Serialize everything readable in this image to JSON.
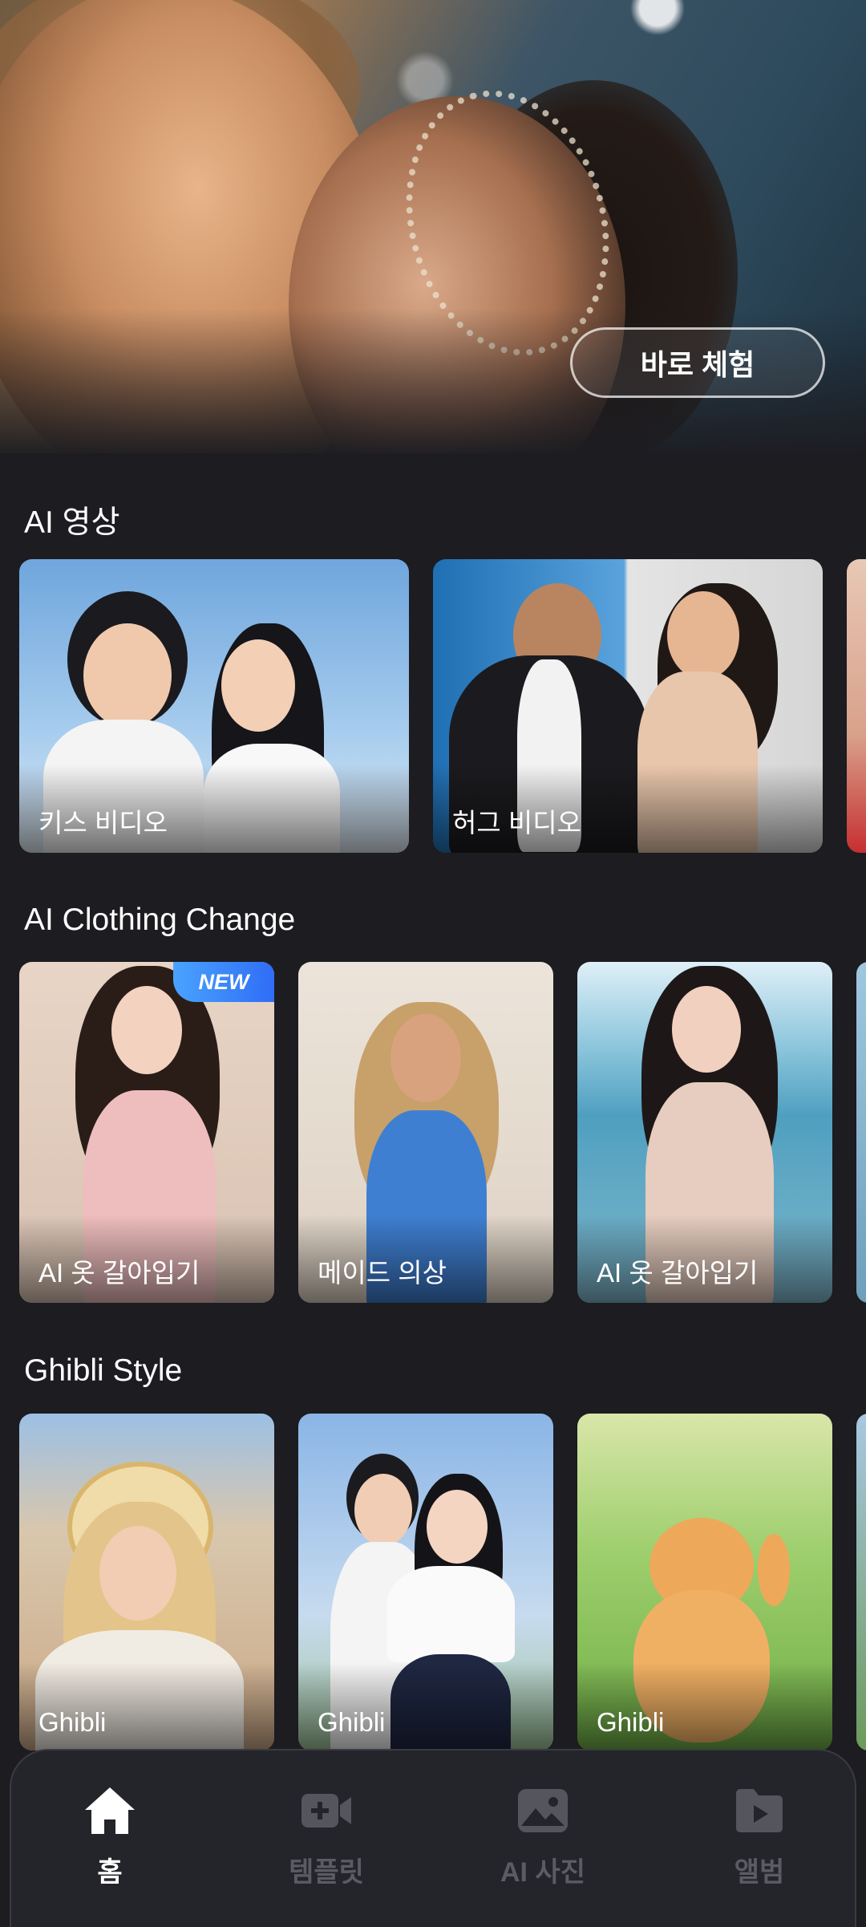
{
  "hero": {
    "cta_label": "바로 체험"
  },
  "sections": [
    {
      "title": "AI 영상",
      "cards": [
        "키스 비디오",
        "허그 비디오",
        ""
      ]
    },
    {
      "title": "AI Clothing Change",
      "cards": [
        "AI 옷 갈아입기",
        "메이드 의상",
        "AI 옷 갈아입기",
        ""
      ],
      "badge": "NEW"
    },
    {
      "title": "Ghibli Style",
      "cards": [
        "Ghibli",
        "Ghibli",
        "Ghibli",
        ""
      ]
    }
  ],
  "nav": {
    "items": [
      {
        "label": "홈",
        "icon": "home-icon",
        "active": true
      },
      {
        "label": "템플릿",
        "icon": "video-add-icon",
        "active": false
      },
      {
        "label": "AI 사진",
        "icon": "photo-icon",
        "active": false
      },
      {
        "label": "앨범",
        "icon": "album-folder-icon",
        "active": false
      }
    ]
  },
  "colors": {
    "background": "#1c1c21",
    "nav_background": "#24242b",
    "badge": "#2f6df6",
    "inactive": "#5b5b63"
  }
}
